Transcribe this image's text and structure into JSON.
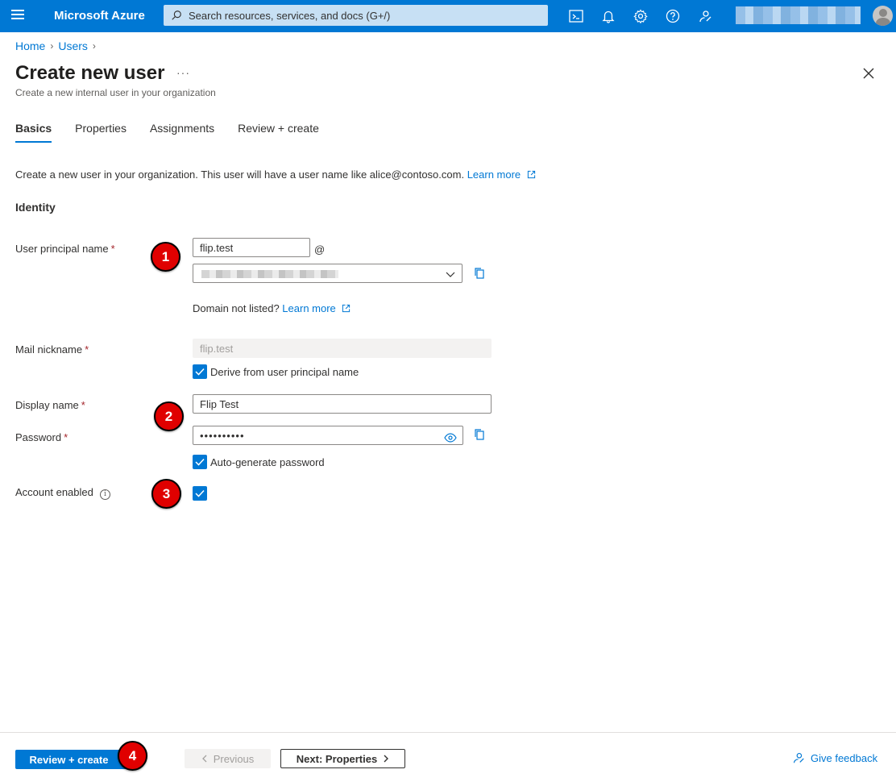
{
  "topbar": {
    "brand": "Microsoft Azure",
    "search_placeholder": "Search resources, services, and docs (G+/)"
  },
  "breadcrumb": [
    "Home",
    "Users"
  ],
  "page": {
    "title": "Create new user",
    "more": "···",
    "subtitle": "Create a new internal user in your organization"
  },
  "tabs": [
    {
      "label": "Basics",
      "active": true
    },
    {
      "label": "Properties",
      "active": false
    },
    {
      "label": "Assignments",
      "active": false
    },
    {
      "label": "Review + create",
      "active": false
    }
  ],
  "intro": {
    "text": "Create a new user in your organization. This user will have a user name like alice@contoso.com.",
    "link": "Learn more"
  },
  "section_title": "Identity",
  "form": {
    "upn_label": "User principal name",
    "upn_value": "flip.test",
    "at": "@",
    "domain_helper": "Domain not listed?",
    "domain_link": "Learn more",
    "mail_label": "Mail nickname",
    "mail_value": "flip.test",
    "derive_label": "Derive from user principal name",
    "display_label": "Display name",
    "display_value": "Flip Test",
    "password_label": "Password",
    "password_value": "••••••••••",
    "autogen_label": "Auto-generate password",
    "account_label": "Account enabled",
    "required": "*",
    "info": "i"
  },
  "markers": [
    "1",
    "2",
    "3",
    "4"
  ],
  "footer": {
    "review_create": "Review + create",
    "previous": "Previous",
    "next": "Next: Properties",
    "feedback": "Give feedback"
  },
  "colors": {
    "topbar": "#0078d4",
    "accent": "#0078d4",
    "required": "#a4262c",
    "marker": "#e00000"
  }
}
